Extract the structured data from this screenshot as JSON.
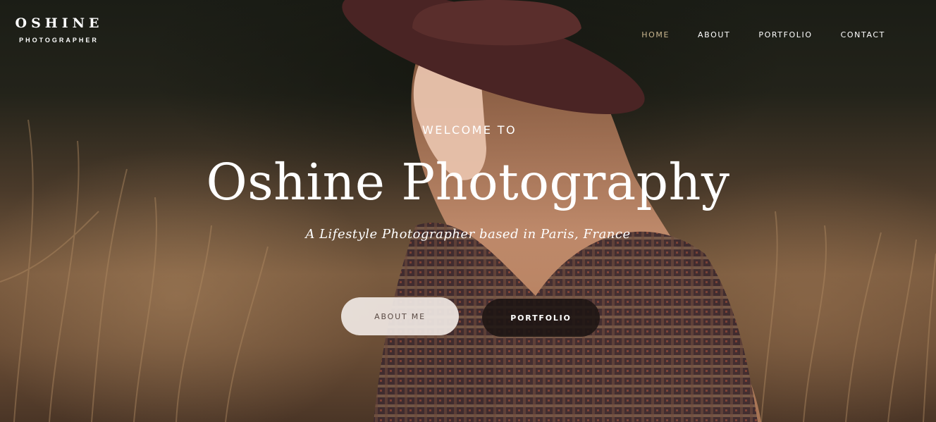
{
  "brand": {
    "title": "OSHINE",
    "subtitle": "PHOTOGRAPHER"
  },
  "nav": {
    "items": [
      {
        "label": "HOME",
        "active": true
      },
      {
        "label": "ABOUT",
        "active": false
      },
      {
        "label": "PORTFOLIO",
        "active": false
      },
      {
        "label": "CONTACT",
        "active": false
      }
    ]
  },
  "hero": {
    "welcome": "WELCOME TO",
    "title": "Oshine Photography",
    "subtitle": "A Lifestyle Photographer based in Paris, France",
    "buttons": {
      "about_label": "ABOUT ME",
      "portfolio_label": "PORTFOLIO"
    }
  },
  "colors": {
    "accent_nav_active": "#c9b68f",
    "text": "#ffffff",
    "button_light": "#f0e8e4",
    "button_dark": "#1c1412"
  }
}
